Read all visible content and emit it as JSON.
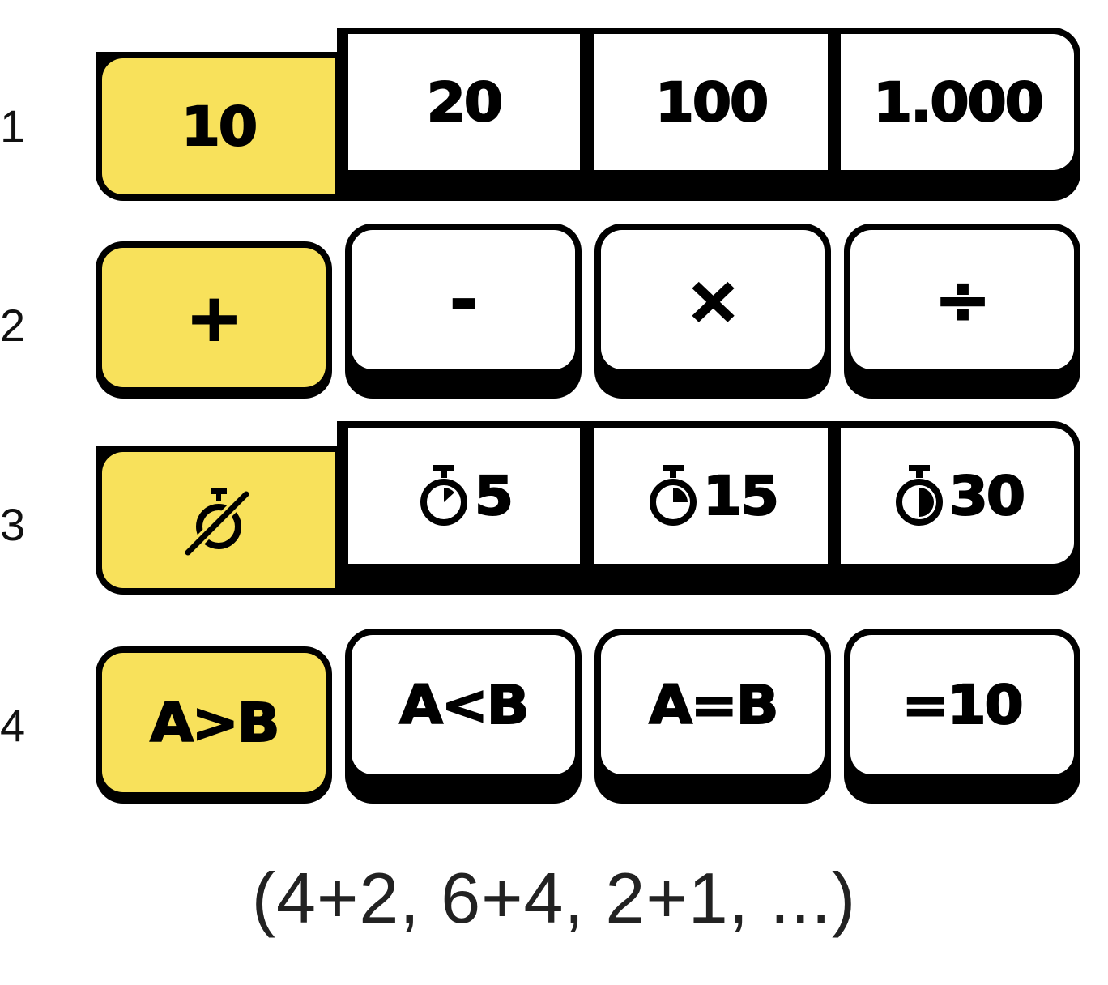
{
  "rows": [
    {
      "number": "1",
      "options": [
        {
          "label": "10",
          "selected": true
        },
        {
          "label": "20",
          "selected": false
        },
        {
          "label": "100",
          "selected": false
        },
        {
          "label": "1.000",
          "selected": false
        }
      ]
    },
    {
      "number": "2",
      "options": [
        {
          "label": "+",
          "selected": true
        },
        {
          "label": "-",
          "selected": false
        },
        {
          "label": "×",
          "selected": false
        },
        {
          "label": "÷",
          "selected": false
        }
      ]
    },
    {
      "number": "3",
      "options": [
        {
          "icon": "no-timer-icon",
          "label": "",
          "selected": true
        },
        {
          "icon": "timer-icon",
          "label": "5",
          "selected": false
        },
        {
          "icon": "timer-icon",
          "label": "15",
          "selected": false
        },
        {
          "icon": "timer-icon",
          "label": "30",
          "selected": false
        }
      ]
    },
    {
      "number": "4",
      "options": [
        {
          "label": "A>B",
          "selected": true
        },
        {
          "label": "A<B",
          "selected": false
        },
        {
          "label": "A=B",
          "selected": false
        },
        {
          "label": "=10",
          "selected": false
        }
      ]
    }
  ],
  "footer_text": "(4+2, 6+4, 2+1, ...)",
  "colors": {
    "selected": "#f8e15b",
    "unselected": "#ffffff",
    "border": "#000000"
  }
}
